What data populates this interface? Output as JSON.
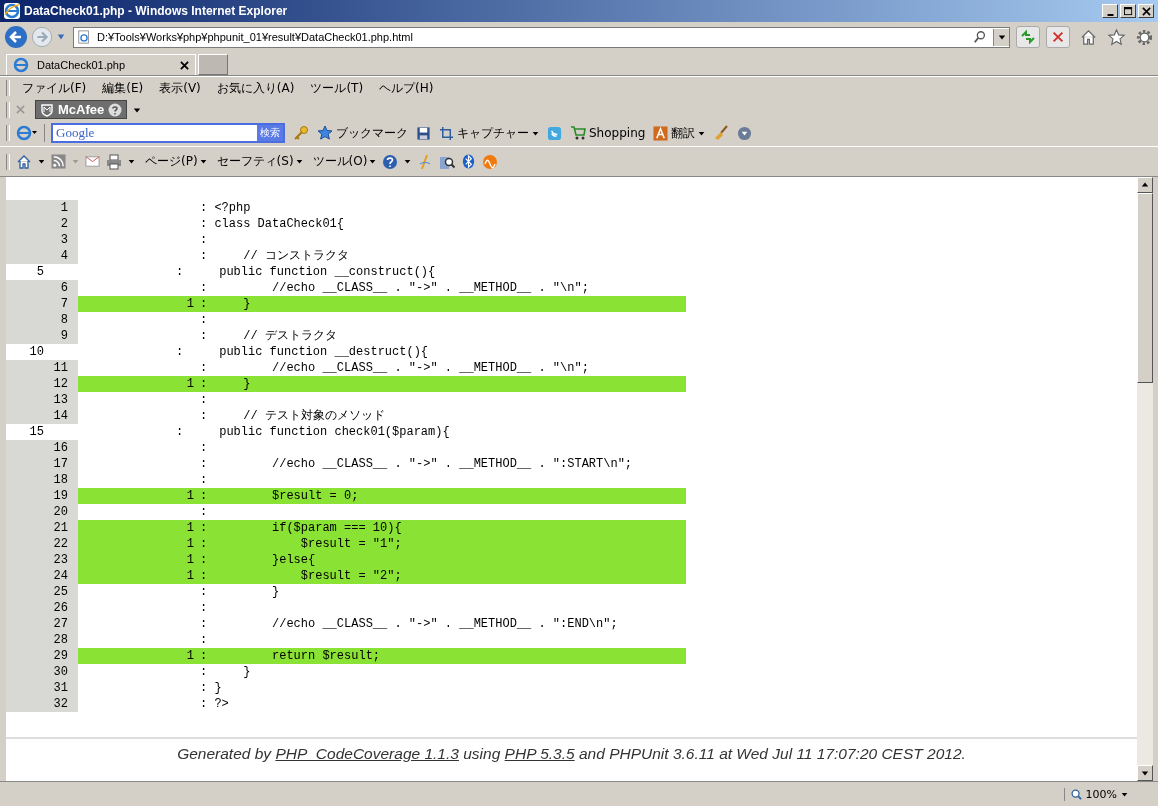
{
  "window": {
    "title": "DataCheck01.php - Windows Internet Explorer"
  },
  "address": {
    "url": "D:¥Tools¥Works¥php¥phpunit_01¥result¥DataCheck01.php.html"
  },
  "tabs": [
    {
      "label": "DataCheck01.php",
      "selected": true
    }
  ],
  "menu": [
    "ファイル(F)",
    "編集(E)",
    "表示(V)",
    "お気に入り(A)",
    "ツール(T)",
    "ヘルプ(H)"
  ],
  "mcafee": {
    "label": "McAfee"
  },
  "google_bar": {
    "placeholder": "Google",
    "search_button": "検索",
    "items": [
      {
        "kind": "key",
        "dropdown": false
      },
      {
        "kind": "star",
        "label": "ブックマーク",
        "dropdown": false
      },
      {
        "kind": "disk",
        "dropdown": false
      },
      {
        "kind": "crop",
        "label": "キャプチャー",
        "dropdown": true
      },
      {
        "kind": "bird",
        "dropdown": false
      },
      {
        "kind": "cart",
        "label": "Shopping",
        "dropdown": false
      },
      {
        "kind": "translate",
        "label": "翻訳",
        "dropdown": true
      },
      {
        "kind": "broom",
        "dropdown": false
      },
      {
        "kind": "circle",
        "dropdown": false
      }
    ]
  },
  "command_bar": [
    "ページ(P)",
    "セーフティ(S)",
    "ツール(O)"
  ],
  "lines": [
    {
      "number": "1",
      "kind": "plain",
      "code": ": <?php"
    },
    {
      "number": "2",
      "kind": "plain",
      "code": ": class DataCheck01{"
    },
    {
      "number": "3",
      "kind": "plain",
      "code": ":"
    },
    {
      "number": "4",
      "kind": "plain",
      "code": ":     // コンストラクタ"
    },
    {
      "number": "5",
      "kind": "shifted",
      "code": ":     public function __construct(){"
    },
    {
      "number": "6",
      "kind": "plain",
      "code": ":         //echo __CLASS__ . \"->\" . __METHOD__ . \"\\n\";"
    },
    {
      "number": "7",
      "kind": "covered",
      "count": "1",
      "code": ":     }"
    },
    {
      "number": "8",
      "kind": "plain",
      "code": ":"
    },
    {
      "number": "9",
      "kind": "plain",
      "code": ":     // デストラクタ"
    },
    {
      "number": "10",
      "kind": "shifted",
      "code": ":     public function __destruct(){"
    },
    {
      "number": "11",
      "kind": "plain",
      "code": ":         //echo __CLASS__ . \"->\" . __METHOD__ . \"\\n\";"
    },
    {
      "number": "12",
      "kind": "covered",
      "count": "1",
      "code": ":     }"
    },
    {
      "number": "13",
      "kind": "plain",
      "code": ":"
    },
    {
      "number": "14",
      "kind": "plain",
      "code": ":     // テスト対象のメソッド"
    },
    {
      "number": "15",
      "kind": "shifted",
      "code": ":     public function check01($param){"
    },
    {
      "number": "16",
      "kind": "plain",
      "code": ":"
    },
    {
      "number": "17",
      "kind": "plain",
      "code": ":         //echo __CLASS__ . \"->\" . __METHOD__ . \":START\\n\";"
    },
    {
      "number": "18",
      "kind": "plain",
      "code": ":"
    },
    {
      "number": "19",
      "kind": "covered",
      "count": "1",
      "code": ":         $result = 0;"
    },
    {
      "number": "20",
      "kind": "plain",
      "code": ":"
    },
    {
      "number": "21",
      "kind": "covered",
      "count": "1",
      "code": ":         if($param === 10){"
    },
    {
      "number": "22",
      "kind": "covered",
      "count": "1",
      "code": ":             $result = \"1\";"
    },
    {
      "number": "23",
      "kind": "covered",
      "count": "1",
      "code": ":         }else{"
    },
    {
      "number": "24",
      "kind": "covered",
      "count": "1",
      "code": ":             $result = \"2\";"
    },
    {
      "number": "25",
      "kind": "plain",
      "code": ":         }"
    },
    {
      "number": "26",
      "kind": "plain",
      "code": ":"
    },
    {
      "number": "27",
      "kind": "plain",
      "code": ":         //echo __CLASS__ . \"->\" . __METHOD__ . \":END\\n\";"
    },
    {
      "number": "28",
      "kind": "plain",
      "code": ":"
    },
    {
      "number": "29",
      "kind": "covered",
      "count": "1",
      "code": ":         return $result;"
    },
    {
      "number": "30",
      "kind": "plain",
      "code": ":     }"
    },
    {
      "number": "31",
      "kind": "plain",
      "code": ": }"
    },
    {
      "number": "32",
      "kind": "plain",
      "code": ": ?>"
    }
  ],
  "footer": [
    {
      "kind": "text",
      "text": "Generated by "
    },
    {
      "kind": "link",
      "text": "PHP_CodeCoverage 1.1.3"
    },
    {
      "kind": "text",
      "text": " using "
    },
    {
      "kind": "link",
      "text": "PHP 5.3.5"
    },
    {
      "kind": "text",
      "text": " and PHPUnit 3.6.11 at Wed Jul 11 17:07:20 CEST 2012."
    }
  ],
  "status_bar": {
    "zoom": "100%"
  }
}
